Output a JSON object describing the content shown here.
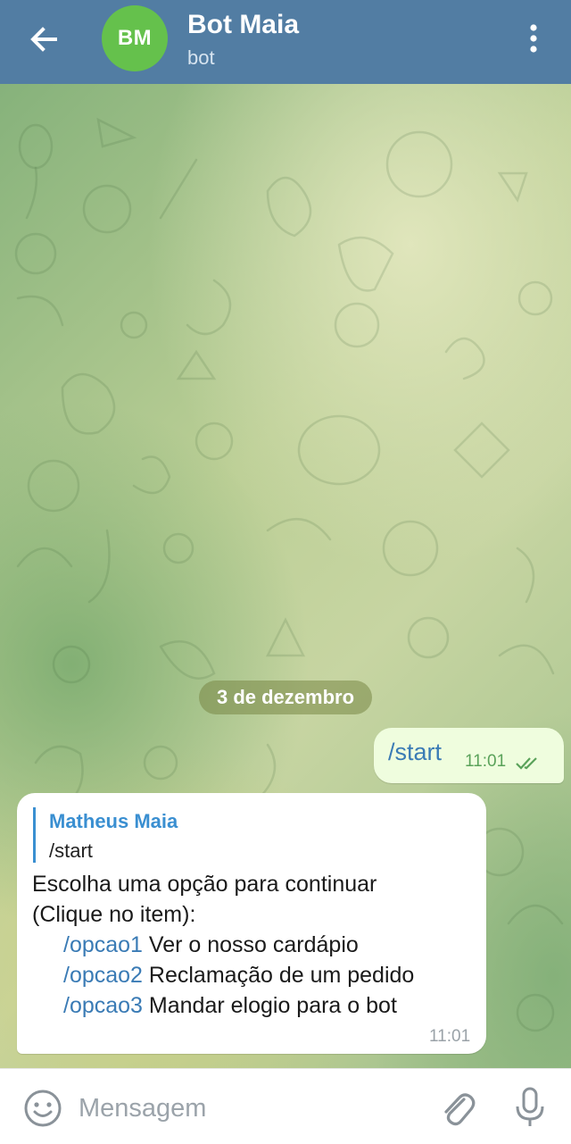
{
  "header": {
    "avatar_initials": "BM",
    "avatar_color": "#65c14c",
    "title": "Bot Maia",
    "subtitle": "bot",
    "background_color": "#527da3",
    "icons": [
      "arrow-left-icon",
      "more-vertical-icon"
    ]
  },
  "chat": {
    "date_separator": "3 de dezembro",
    "messages": [
      {
        "direction": "outgoing",
        "text": "/start",
        "time": "11:01",
        "status": "read"
      },
      {
        "direction": "incoming",
        "reply_to": {
          "author": "Matheus Maia",
          "text": "/start"
        },
        "lines": [
          "Escolha uma opção para continuar",
          "(Clique no item):"
        ],
        "options": [
          {
            "command": "/opcao1",
            "label": "Ver o nosso cardápio"
          },
          {
            "command": "/opcao2",
            "label": "Reclamação de um pedido"
          },
          {
            "command": "/opcao3",
            "label": "Mandar elogio para o bot"
          }
        ],
        "time": "11:01"
      }
    ]
  },
  "input_bar": {
    "placeholder": "Mensagem",
    "value": "",
    "icons": [
      "emoji-icon",
      "paperclip-icon",
      "microphone-icon"
    ]
  },
  "colors": {
    "link": "#3a7bb5",
    "outgoing_bubble": "#effdde",
    "read_check": "#5aa25a"
  }
}
